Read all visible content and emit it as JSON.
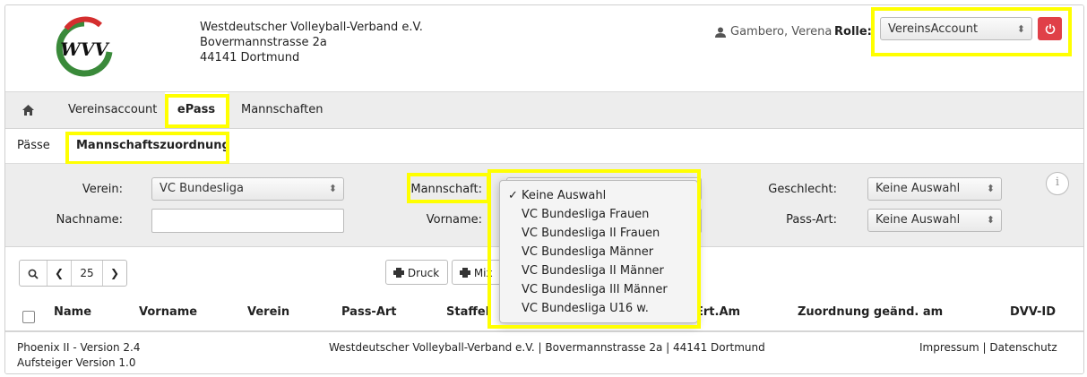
{
  "header": {
    "org_lines": [
      "Westdeutscher Volleyball-Verband e.V.",
      "Bovermannstrasse 2a",
      "44141 Dortmund"
    ],
    "user_name": "Gambero, Verena",
    "role_label": "Rolle:",
    "role_value": "VereinsAccount",
    "logo_text": "WVV"
  },
  "nav": {
    "items": [
      {
        "label": "Vereinsaccount",
        "active": false
      },
      {
        "label": "ePass",
        "active": true
      },
      {
        "label": "Mannschaften",
        "active": false
      }
    ]
  },
  "subnav": {
    "items": [
      {
        "label": "Pässe",
        "active": false
      },
      {
        "label": "Mannschaftszuordnung",
        "active": true
      }
    ]
  },
  "filters": {
    "verein_label": "Verein:",
    "verein_value": "VC Bundesliga",
    "nachname_label": "Nachname:",
    "nachname_value": "",
    "mannschaft_label": "Mannschaft:",
    "vorname_label": "Vorname:",
    "vorname_value": "",
    "geschlecht_label": "Geschlecht:",
    "geschlecht_value": "Keine Auswahl",
    "passart_label": "Pass-Art:",
    "passart_value": "Keine Auswahl"
  },
  "mannschaft_dropdown": {
    "options": [
      "Keine Auswahl",
      "VC Bundesliga Frauen",
      "VC Bundesliga II Frauen",
      "VC Bundesliga Männer",
      "VC Bundesliga II Männer",
      "VC Bundesliga III Männer",
      "VC Bundesliga U16 w."
    ],
    "selected_index": 0
  },
  "toolbar": {
    "page_size": "25",
    "print_label": "Druck",
    "mix_label": "Mix"
  },
  "table": {
    "columns": [
      "Name",
      "Vorname",
      "Verein",
      "Pass-Art",
      "Staffel",
      "Ert.Am",
      "Zuordnung geänd. am",
      "DVV-ID"
    ]
  },
  "footer": {
    "version_line1": "Phoenix II - Version 2.4",
    "version_line2": "Aufsteiger Version 1.0",
    "address": "Westdeutscher Volleyball-Verband e.V. | Bovermannstrasse 2a | 44141 Dortmund",
    "impressum": "Impressum",
    "separator": " | ",
    "datenschutz": "Datenschutz"
  },
  "colors": {
    "highlight": "#ffff00",
    "logout_red": "#e04048",
    "logo_green": "#3a8a3a",
    "logo_red": "#d42e2e"
  },
  "icons": {
    "home": "home-icon",
    "user": "user-icon",
    "power": "power-icon",
    "info": "info-icon",
    "search": "search-icon",
    "printer": "printer-icon"
  }
}
